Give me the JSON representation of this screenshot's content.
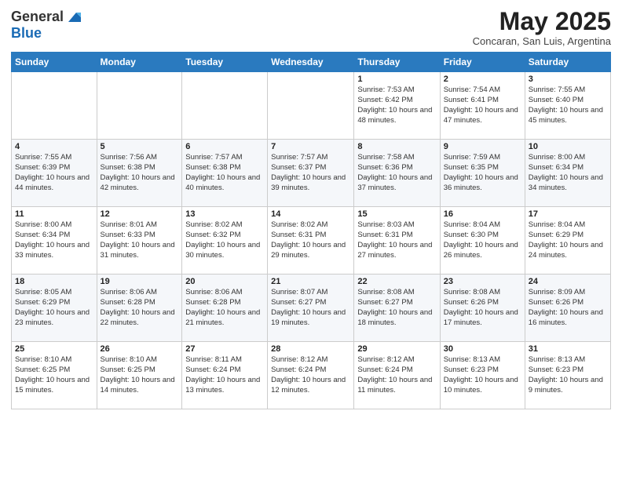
{
  "logo": {
    "general": "General",
    "blue": "Blue"
  },
  "title": "May 2025",
  "subtitle": "Concaran, San Luis, Argentina",
  "days_of_week": [
    "Sunday",
    "Monday",
    "Tuesday",
    "Wednesday",
    "Thursday",
    "Friday",
    "Saturday"
  ],
  "weeks": [
    [
      {
        "num": "",
        "info": ""
      },
      {
        "num": "",
        "info": ""
      },
      {
        "num": "",
        "info": ""
      },
      {
        "num": "",
        "info": ""
      },
      {
        "num": "1",
        "info": "Sunrise: 7:53 AM\nSunset: 6:42 PM\nDaylight: 10 hours and 48 minutes."
      },
      {
        "num": "2",
        "info": "Sunrise: 7:54 AM\nSunset: 6:41 PM\nDaylight: 10 hours and 47 minutes."
      },
      {
        "num": "3",
        "info": "Sunrise: 7:55 AM\nSunset: 6:40 PM\nDaylight: 10 hours and 45 minutes."
      }
    ],
    [
      {
        "num": "4",
        "info": "Sunrise: 7:55 AM\nSunset: 6:39 PM\nDaylight: 10 hours and 44 minutes."
      },
      {
        "num": "5",
        "info": "Sunrise: 7:56 AM\nSunset: 6:38 PM\nDaylight: 10 hours and 42 minutes."
      },
      {
        "num": "6",
        "info": "Sunrise: 7:57 AM\nSunset: 6:38 PM\nDaylight: 10 hours and 40 minutes."
      },
      {
        "num": "7",
        "info": "Sunrise: 7:57 AM\nSunset: 6:37 PM\nDaylight: 10 hours and 39 minutes."
      },
      {
        "num": "8",
        "info": "Sunrise: 7:58 AM\nSunset: 6:36 PM\nDaylight: 10 hours and 37 minutes."
      },
      {
        "num": "9",
        "info": "Sunrise: 7:59 AM\nSunset: 6:35 PM\nDaylight: 10 hours and 36 minutes."
      },
      {
        "num": "10",
        "info": "Sunrise: 8:00 AM\nSunset: 6:34 PM\nDaylight: 10 hours and 34 minutes."
      }
    ],
    [
      {
        "num": "11",
        "info": "Sunrise: 8:00 AM\nSunset: 6:34 PM\nDaylight: 10 hours and 33 minutes."
      },
      {
        "num": "12",
        "info": "Sunrise: 8:01 AM\nSunset: 6:33 PM\nDaylight: 10 hours and 31 minutes."
      },
      {
        "num": "13",
        "info": "Sunrise: 8:02 AM\nSunset: 6:32 PM\nDaylight: 10 hours and 30 minutes."
      },
      {
        "num": "14",
        "info": "Sunrise: 8:02 AM\nSunset: 6:31 PM\nDaylight: 10 hours and 29 minutes."
      },
      {
        "num": "15",
        "info": "Sunrise: 8:03 AM\nSunset: 6:31 PM\nDaylight: 10 hours and 27 minutes."
      },
      {
        "num": "16",
        "info": "Sunrise: 8:04 AM\nSunset: 6:30 PM\nDaylight: 10 hours and 26 minutes."
      },
      {
        "num": "17",
        "info": "Sunrise: 8:04 AM\nSunset: 6:29 PM\nDaylight: 10 hours and 24 minutes."
      }
    ],
    [
      {
        "num": "18",
        "info": "Sunrise: 8:05 AM\nSunset: 6:29 PM\nDaylight: 10 hours and 23 minutes."
      },
      {
        "num": "19",
        "info": "Sunrise: 8:06 AM\nSunset: 6:28 PM\nDaylight: 10 hours and 22 minutes."
      },
      {
        "num": "20",
        "info": "Sunrise: 8:06 AM\nSunset: 6:28 PM\nDaylight: 10 hours and 21 minutes."
      },
      {
        "num": "21",
        "info": "Sunrise: 8:07 AM\nSunset: 6:27 PM\nDaylight: 10 hours and 19 minutes."
      },
      {
        "num": "22",
        "info": "Sunrise: 8:08 AM\nSunset: 6:27 PM\nDaylight: 10 hours and 18 minutes."
      },
      {
        "num": "23",
        "info": "Sunrise: 8:08 AM\nSunset: 6:26 PM\nDaylight: 10 hours and 17 minutes."
      },
      {
        "num": "24",
        "info": "Sunrise: 8:09 AM\nSunset: 6:26 PM\nDaylight: 10 hours and 16 minutes."
      }
    ],
    [
      {
        "num": "25",
        "info": "Sunrise: 8:10 AM\nSunset: 6:25 PM\nDaylight: 10 hours and 15 minutes."
      },
      {
        "num": "26",
        "info": "Sunrise: 8:10 AM\nSunset: 6:25 PM\nDaylight: 10 hours and 14 minutes."
      },
      {
        "num": "27",
        "info": "Sunrise: 8:11 AM\nSunset: 6:24 PM\nDaylight: 10 hours and 13 minutes."
      },
      {
        "num": "28",
        "info": "Sunrise: 8:12 AM\nSunset: 6:24 PM\nDaylight: 10 hours and 12 minutes."
      },
      {
        "num": "29",
        "info": "Sunrise: 8:12 AM\nSunset: 6:24 PM\nDaylight: 10 hours and 11 minutes."
      },
      {
        "num": "30",
        "info": "Sunrise: 8:13 AM\nSunset: 6:23 PM\nDaylight: 10 hours and 10 minutes."
      },
      {
        "num": "31",
        "info": "Sunrise: 8:13 AM\nSunset: 6:23 PM\nDaylight: 10 hours and 9 minutes."
      }
    ]
  ]
}
